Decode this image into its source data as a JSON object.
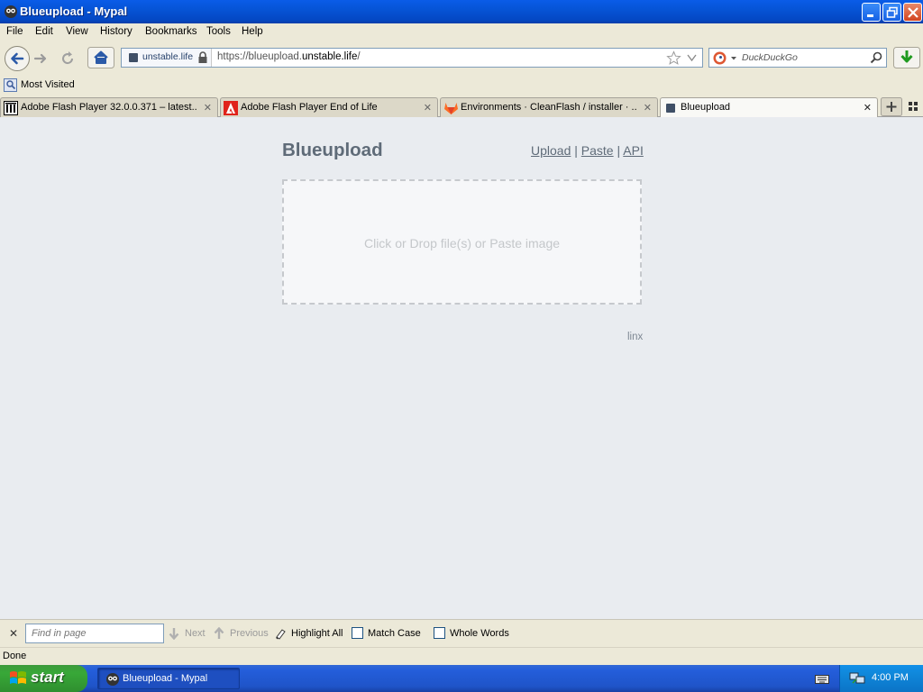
{
  "window": {
    "title": "Blueupload - Mypal",
    "minimize_label": "Minimize",
    "maximize_label": "Maximize",
    "close_label": "Close"
  },
  "menu": [
    "File",
    "Edit",
    "View",
    "History",
    "Bookmarks",
    "Tools",
    "Help"
  ],
  "nav": {
    "site_identity": "unstable.life",
    "url_prefix": "https://blueupload.",
    "url_domain": "unstable.life",
    "url_suffix": "/",
    "search_placeholder": "DuckDuckGo"
  },
  "bookmarks": {
    "most_visited": "Most Visited"
  },
  "tabs": [
    {
      "label": "Adobe Flash Player 32.0.0.371 – latest..."
    },
    {
      "label": "Adobe Flash Player End of Life"
    },
    {
      "label": "Environments · CleanFlash / installer · ..."
    },
    {
      "label": "Blueupload"
    }
  ],
  "page": {
    "brand": "Blueupload",
    "links": [
      "Upload",
      "Paste",
      "API"
    ],
    "separator": "|",
    "dropzone_text": "Click or Drop file(s) or Paste image",
    "footer_link": "linx"
  },
  "findbar": {
    "placeholder": "Find in page",
    "next": "Next",
    "previous": "Previous",
    "highlight_all": "Highlight All",
    "match_case": "Match Case",
    "whole_words": "Whole Words"
  },
  "status": {
    "text": "Done"
  },
  "taskbar": {
    "start_label": "start",
    "task_label": "Blueupload - Mypal",
    "clock": "4:00 PM"
  },
  "colors": {
    "content_bg": "#e9ecf0",
    "brand_text": "#5f6b78",
    "dropzone_text": "#c4c7ca",
    "xp_blue": "#0654d6"
  }
}
